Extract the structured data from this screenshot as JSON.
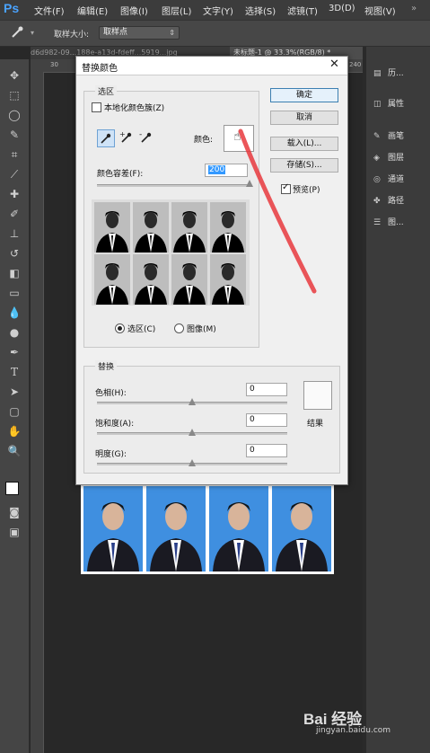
{
  "app": {
    "logo": "Ps",
    "menu": [
      "文件(F)",
      "编辑(E)",
      "图像(I)",
      "图层(L)",
      "文字(Y)",
      "选择(S)",
      "滤镜(T)",
      "3D(D)",
      "视图(V)"
    ]
  },
  "options_bar": {
    "sample_size_label": "取样大小:",
    "sample_size_value": "取样点"
  },
  "tabs": {
    "doc1": "d6d982-09...188e-a13d-fdeff...5919...jpg",
    "doc2": "未标题-1 @ 33.3%(RGB/8) *"
  },
  "ruler": {
    "top_30": "30",
    "top_240": "240"
  },
  "right_panel": {
    "items": [
      "历...",
      "属性",
      "画笔",
      "图层",
      "通道",
      "路径",
      "图..."
    ]
  },
  "dialog": {
    "title": "替换颜色",
    "selection_group": "选区",
    "localized_color_clusters": "本地化颜色簇(Z)",
    "color_label": "颜色:",
    "fuzziness_label": "颜色容差(F):",
    "fuzziness_value": "200",
    "fuzziness_fraction": 1.0,
    "radio_selection": "选区(C)",
    "radio_image": "图像(M)",
    "ok": "确定",
    "cancel": "取消",
    "load": "载入(L)...",
    "save": "存储(S)...",
    "preview": "预览(P)",
    "replacement_group": "替换",
    "hue_label": "色相(H):",
    "hue_value": "0",
    "saturation_label": "饱和度(A):",
    "saturation_value": "0",
    "lightness_label": "明度(G):",
    "lightness_value": "0",
    "result_label": "结果"
  },
  "watermark": {
    "brand": "Bai 经验",
    "url": "jingyan.baidu.com"
  },
  "colors": {
    "photo_bg": "#3f8fe0",
    "accent_blue": "#3c7fb1",
    "selection_highlight": "#3399ff"
  }
}
